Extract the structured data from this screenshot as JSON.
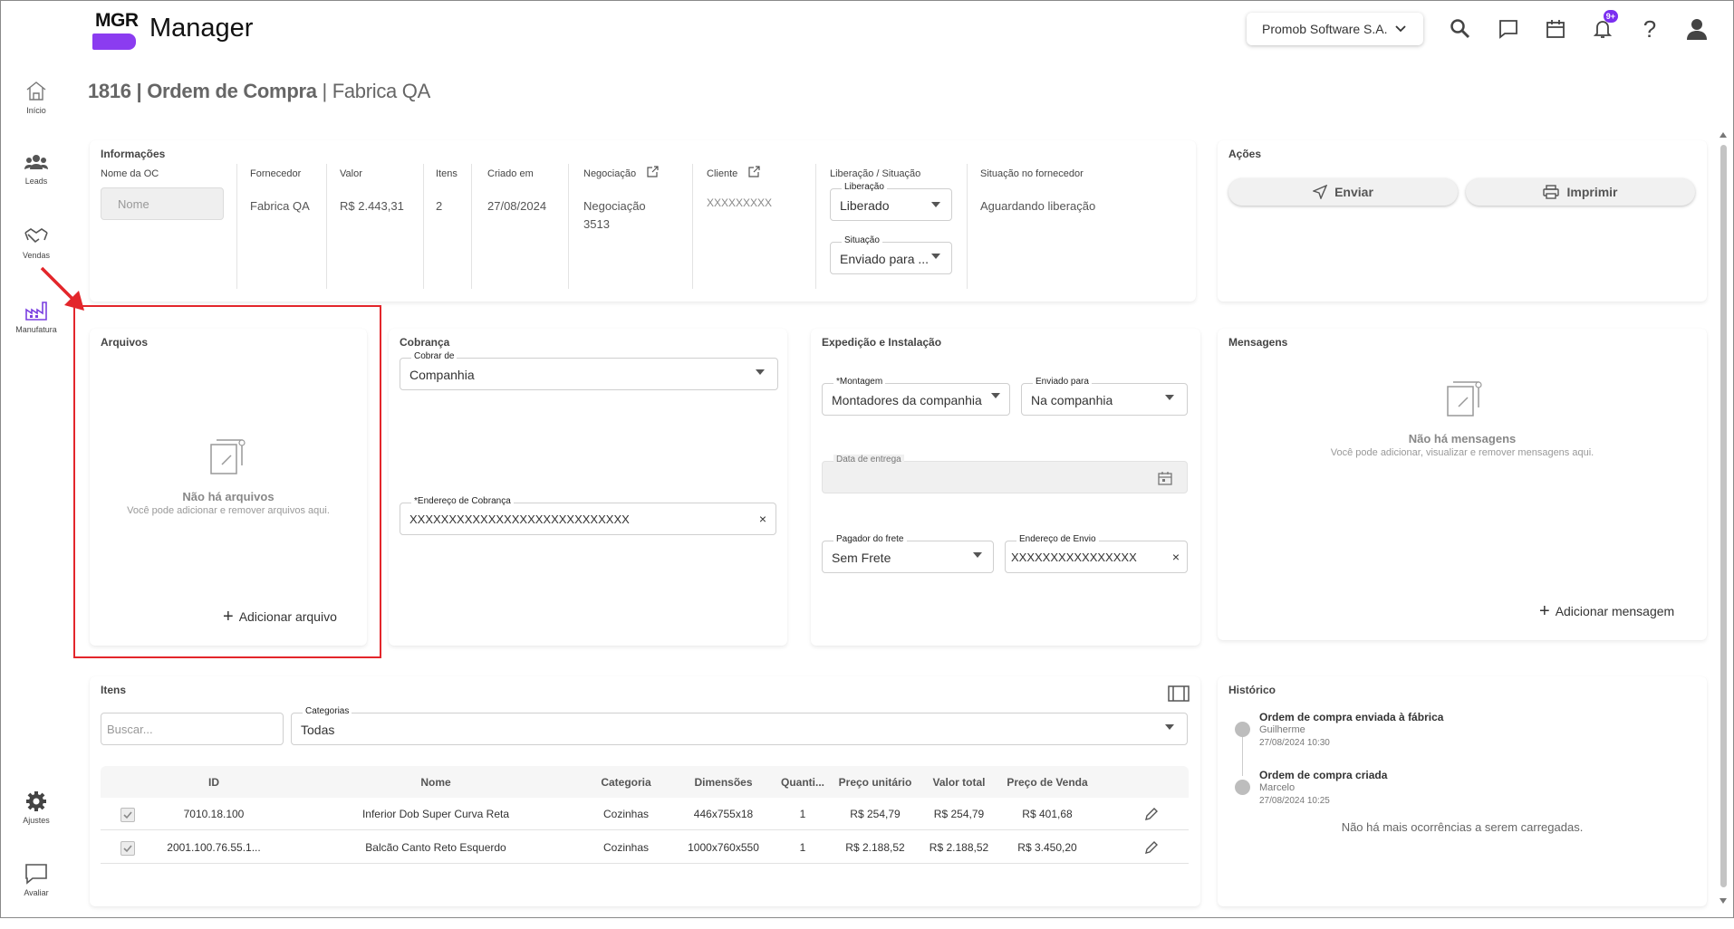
{
  "app": {
    "logo_text": "MGR",
    "name": "Manager",
    "company_selector": "Promob Software S.A.",
    "notification_badge": "9+"
  },
  "nav": {
    "items": [
      {
        "label": "Início",
        "icon": "home-icon"
      },
      {
        "label": "Leads",
        "icon": "people-icon"
      },
      {
        "label": "Vendas",
        "icon": "handshake-icon"
      },
      {
        "label": "Manufatura",
        "icon": "factory-icon"
      }
    ],
    "bottom": [
      {
        "label": "Ajustes",
        "icon": "gear-icon"
      },
      {
        "label": "Avaliar",
        "icon": "chat-icon"
      }
    ]
  },
  "page": {
    "title_bold": "1816 | Ordem de Compra",
    "title_rest": " | Fabrica QA"
  },
  "info": {
    "title": "Informações",
    "name_label": "Nome da OC",
    "name_placeholder": "Nome",
    "supplier_label": "Fornecedor",
    "supplier_value": "Fabrica QA",
    "value_label": "Valor",
    "value_value": "R$ 2.443,31",
    "items_label": "Itens",
    "items_value": "2",
    "created_label": "Criado em",
    "created_value": "27/08/2024",
    "negotiation_label": "Negociação",
    "negotiation_value_1": "Negociação",
    "negotiation_value_2": "3513",
    "client_label": "Cliente",
    "client_value": "XXXXXXXXX",
    "release_status_label": "Liberação / Situação",
    "release_field_label": "Liberação",
    "release_field_value": "Liberado",
    "status_field_label": "Situação",
    "status_field_value": "Enviado para ...",
    "supplier_status_label": "Situação no fornecedor",
    "supplier_status_value": "Aguardando liberação"
  },
  "actions": {
    "title": "Ações",
    "send": "Enviar",
    "print": "Imprimir"
  },
  "files": {
    "title": "Arquivos",
    "empty_title": "Não há arquivos",
    "empty_sub": "Você pode adicionar e remover arquivos aqui.",
    "add": "Adicionar arquivo"
  },
  "billing": {
    "title": "Cobrança",
    "charge_label": "Cobrar de",
    "charge_value": "Companhia",
    "address_label": "Endereço de Cobrança",
    "address_value": "XXXXXXXXXXXXXXXXXXXXXXXXXXXX"
  },
  "shipping": {
    "title": "Expedição e Instalação",
    "assembly_label": "Montagem",
    "assembly_value": "Montadores da companhia",
    "sent_to_label": "Enviado para",
    "sent_to_value": "Na companhia",
    "delivery_label": "Data de entrega",
    "freight_label": "Pagador do frete",
    "freight_value": "Sem Frete",
    "ship_address_label": "Endereço de Envio",
    "ship_address_value": "XXXXXXXXXXXXXXXX"
  },
  "messages": {
    "title": "Mensagens",
    "empty_title": "Não há mensagens",
    "empty_sub": "Você pode adicionar, visualizar e remover mensagens aqui.",
    "add": "Adicionar mensagem"
  },
  "items": {
    "title": "Itens",
    "search_placeholder": "Buscar...",
    "category_label": "Categorias",
    "category_value": "Todas",
    "columns": [
      "ID",
      "Nome",
      "Categoria",
      "Dimensões",
      "Quanti...",
      "Preço unitário",
      "Valor total",
      "Preço de Venda"
    ],
    "rows": [
      {
        "id": "7010.18.100",
        "name": "Inferior Dob Super Curva Reta",
        "category": "Cozinhas",
        "dims": "446x755x18",
        "qty": "1",
        "unit": "R$ 254,79",
        "total": "R$ 254,79",
        "sale": "R$ 401,68"
      },
      {
        "id": "2001.100.76.55.1...",
        "name": "Balcão Canto Reto Esquerdo",
        "category": "Cozinhas",
        "dims": "1000x760x550",
        "qty": "1",
        "unit": "R$ 2.188,52",
        "total": "R$ 2.188,52",
        "sale": "R$ 3.450,20"
      }
    ]
  },
  "history": {
    "title": "Histórico",
    "events": [
      {
        "title": "Ordem de compra enviada à fábrica",
        "user": "Guilherme",
        "date": "27/08/2024 10:30"
      },
      {
        "title": "Ordem de compra criada",
        "user": "Marcelo",
        "date": "27/08/2024 10:25"
      }
    ],
    "end_text": "Não há mais ocorrências a serem carregadas."
  },
  "colors": {
    "brand": "#8b3cf0",
    "highlight": "#e3262b"
  }
}
